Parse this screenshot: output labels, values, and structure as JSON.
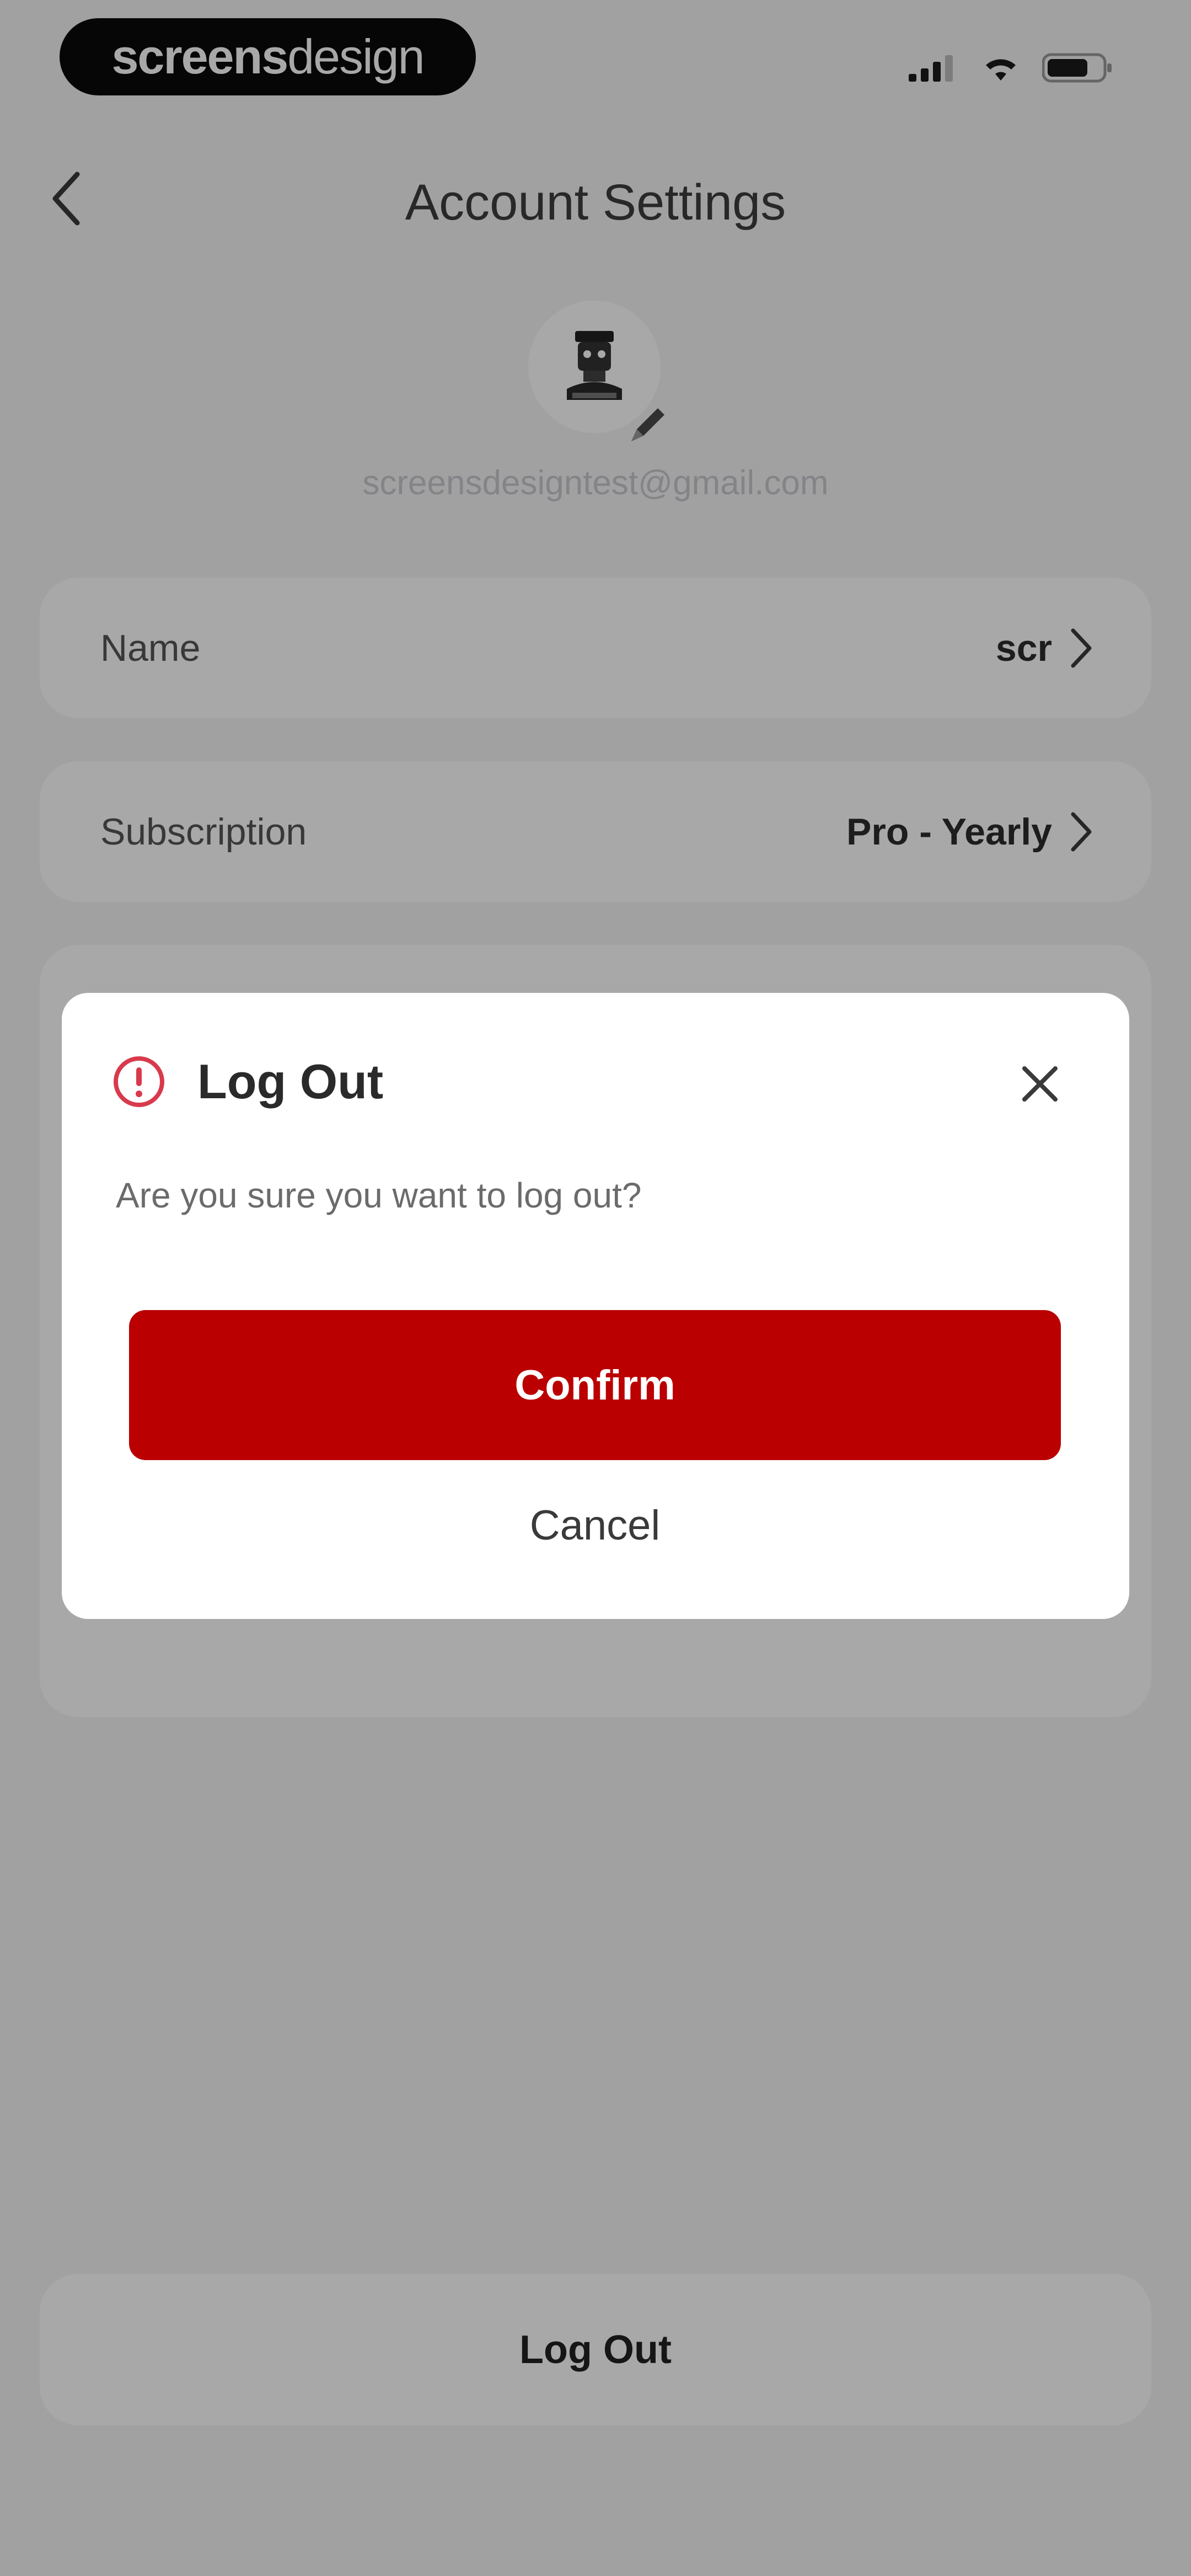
{
  "status_bar": {
    "brand_bold": "screens",
    "brand_light": "design",
    "icons": [
      "signal-icon",
      "wifi-icon",
      "battery-icon"
    ]
  },
  "header": {
    "title": "Account Settings",
    "back_icon": "chevron-left-icon"
  },
  "profile": {
    "email": "screensdesigntest@gmail.com",
    "avatar_icon": "avatar-icon",
    "edit_icon": "pencil-icon"
  },
  "settings": {
    "rows": [
      {
        "label": "Name",
        "value": "scr"
      },
      {
        "label": "Subscription",
        "value": "Pro - Yearly"
      }
    ]
  },
  "footer": {
    "logout_label": "Log Out"
  },
  "modal": {
    "title": "Log Out",
    "message": "Are you sure you want to log out?",
    "confirm_label": "Confirm",
    "cancel_label": "Cancel",
    "alert_icon": "alert-circle-icon",
    "close_icon": "close-icon"
  },
  "colors": {
    "accent_red": "#ba0000",
    "alert_red": "#d83a4c",
    "overlay": "rgba(0,0,0,0.34)"
  }
}
